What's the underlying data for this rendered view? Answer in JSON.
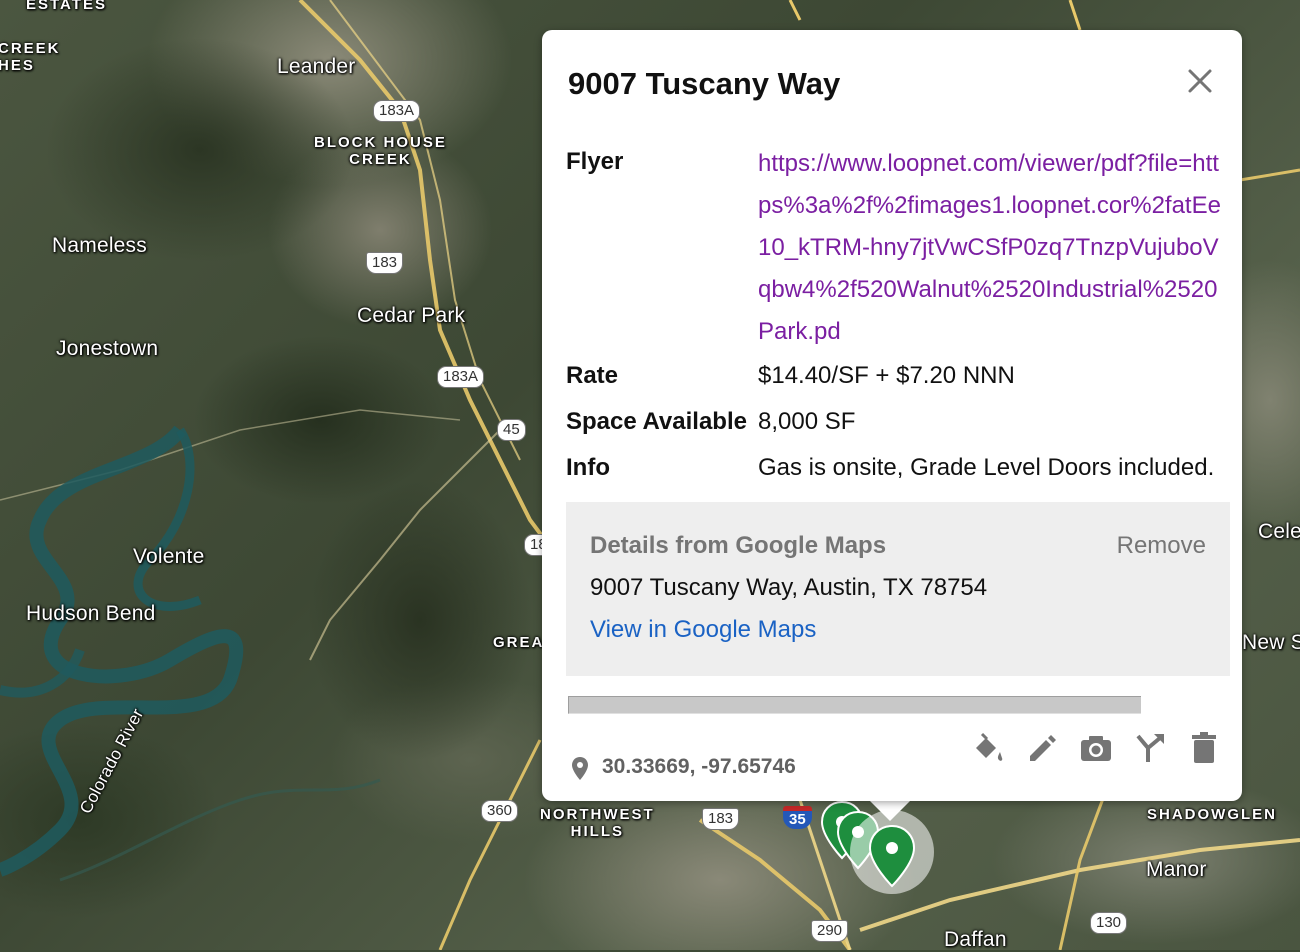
{
  "map": {
    "places": [
      {
        "id": "estates",
        "label": "ESTATES"
      },
      {
        "id": "creek-hes",
        "label": "CREEK\nHES"
      },
      {
        "id": "leander",
        "label": "Leander"
      },
      {
        "id": "block-house-creek",
        "label": "BLOCK HOUSE\nCREEK"
      },
      {
        "id": "nameless",
        "label": "Nameless"
      },
      {
        "id": "cedar-park",
        "label": "Cedar Park"
      },
      {
        "id": "jonestown",
        "label": "Jonestown"
      },
      {
        "id": "volente",
        "label": "Volente"
      },
      {
        "id": "hudson-bend",
        "label": "Hudson Bend"
      },
      {
        "id": "colorado-river",
        "label": "Colorado River"
      },
      {
        "id": "grea",
        "label": "GREA"
      },
      {
        "id": "northwest-hills",
        "label": "NORTHWEST\nHILLS"
      },
      {
        "id": "shadowglen",
        "label": "SHADOWGLEN"
      },
      {
        "id": "manor",
        "label": "Manor"
      },
      {
        "id": "daffan",
        "label": "Daffan"
      },
      {
        "id": "cele",
        "label": "Cele"
      },
      {
        "id": "new",
        "label": "New S"
      }
    ],
    "shields": [
      {
        "id": "183a-top",
        "label": "183A"
      },
      {
        "id": "183-mid",
        "label": "183"
      },
      {
        "id": "183a-mid",
        "label": "183A"
      },
      {
        "id": "45",
        "label": "45"
      },
      {
        "id": "18-partial",
        "label": "18"
      },
      {
        "id": "360",
        "label": "360"
      },
      {
        "id": "183-bottom",
        "label": "183"
      },
      {
        "id": "35",
        "label": "35"
      },
      {
        "id": "290",
        "label": "290"
      },
      {
        "id": "130",
        "label": "130"
      }
    ],
    "marker_color": "#1e8e3e"
  },
  "popup": {
    "title": "9007 Tuscany Way",
    "attributes": {
      "flyer_label": "Flyer",
      "flyer_value": "https://www.loopnet.com/viewer/pdf?file=https%3a%2f%2fimages1.loopnet.cor%2fatEe10_kTRM-hny7jtVwCSfP0zq7TnzpVujuboVqbw4%2f520Walnut%2520Industrial%2520Park.pd",
      "rate_label": "Rate",
      "rate_value": "$14.40/SF + $7.20 NNN",
      "space_label": "Space Available",
      "space_value": "8,000 SF",
      "info_label": "Info",
      "info_value": "Gas is onsite, Grade Level Doors included."
    },
    "google_details": {
      "heading": "Details from Google Maps",
      "remove_label": "Remove",
      "address": "9007 Tuscany Way, Austin, TX 78754",
      "view_link": "View in Google Maps"
    },
    "coordinates": "30.33669, -97.65746",
    "tools": [
      "paint-bucket-icon",
      "pencil-icon",
      "camera-icon",
      "directions-icon",
      "trash-icon"
    ],
    "link_color": "#7b1fa2",
    "view_link_color": "#1a62c4"
  }
}
